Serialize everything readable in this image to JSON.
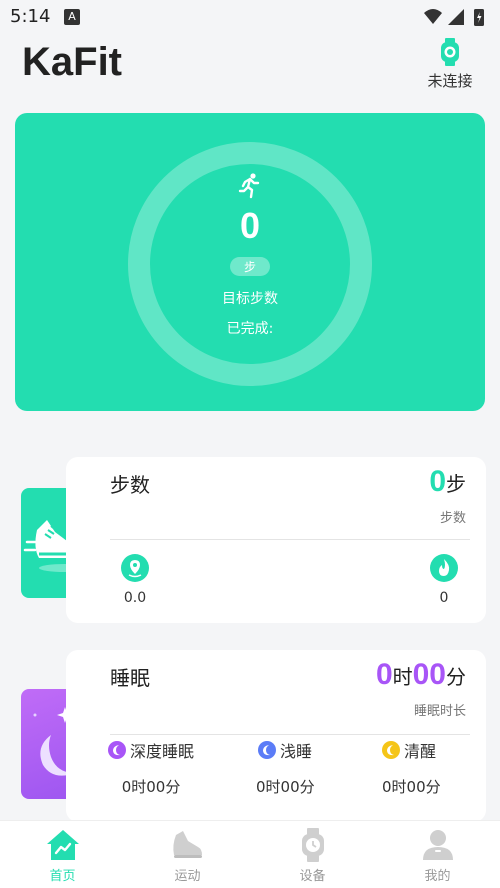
{
  "status_bar": {
    "time": "5:14",
    "notification_icon": "A"
  },
  "header": {
    "app_title": "KaFit",
    "device_status": "未连接"
  },
  "hero": {
    "steps": "0",
    "unit": "步",
    "goal_label": "目标步数",
    "completed_label": "已完成:"
  },
  "steps_card": {
    "title": "步数",
    "value": "0",
    "value_unit": "步",
    "sub_label": "步数",
    "distance_value": "0.0",
    "calories_value": "0"
  },
  "sleep_card": {
    "title": "睡眠",
    "hours": "0",
    "hours_unit": "时",
    "minutes": "00",
    "minutes_unit": "分",
    "sub_label": "睡眠时长",
    "stages": [
      {
        "label": "深度睡眠",
        "value": "0时00分",
        "color": "#a855f7"
      },
      {
        "label": "浅睡",
        "value": "0时00分",
        "color": "#5b7cf7"
      },
      {
        "label": "清醒",
        "value": "0时00分",
        "color": "#f5c518"
      }
    ]
  },
  "colors": {
    "accent": "#23ddb0",
    "sleep_accent": "#a855f7"
  },
  "nav": [
    {
      "label": "首页",
      "icon": "home-icon",
      "active": true
    },
    {
      "label": "运动",
      "icon": "shoe-icon",
      "active": false
    },
    {
      "label": "设备",
      "icon": "watch-icon",
      "active": false
    },
    {
      "label": "我的",
      "icon": "user-icon",
      "active": false
    }
  ]
}
